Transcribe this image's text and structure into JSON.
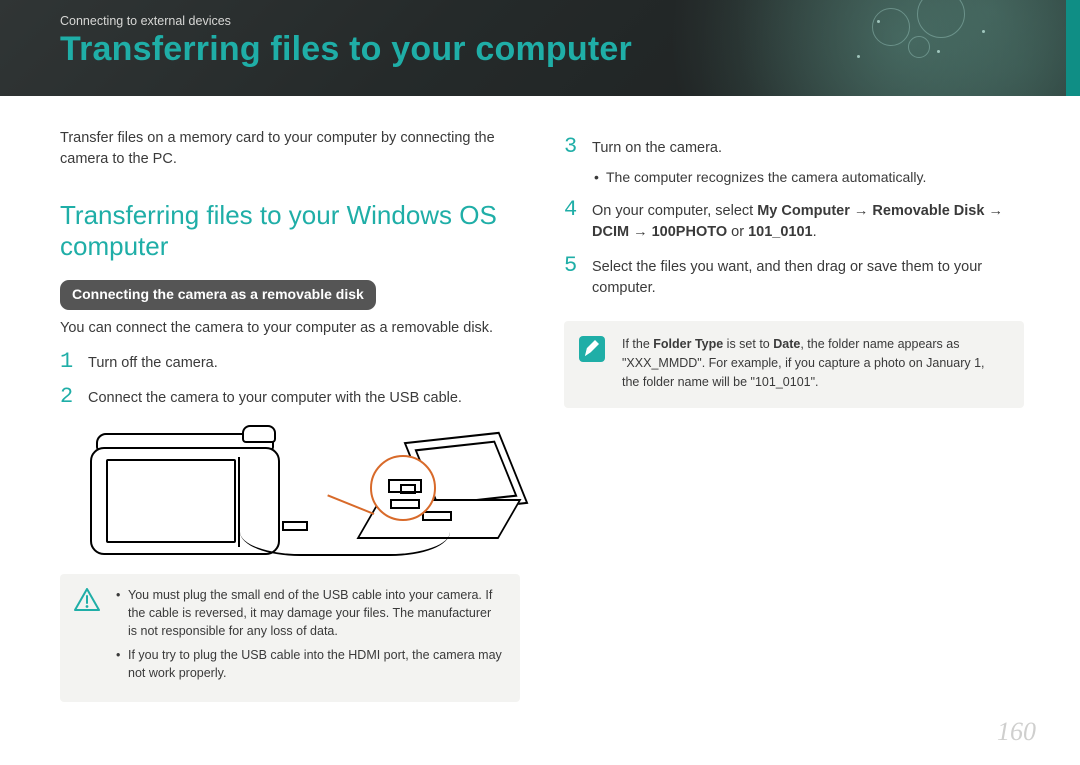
{
  "header": {
    "breadcrumb": "Connecting to external devices",
    "title": "Transferring files to your computer"
  },
  "left": {
    "intro": "Transfer files on a memory card to your computer by connecting the camera to the PC.",
    "section_heading": "Transferring files to your Windows OS computer",
    "pill": "Connecting the camera as a removable disk",
    "subnote": "You can connect the camera to your computer as a removable disk.",
    "step1_num": "1",
    "step1_text": "Turn off the camera.",
    "step2_num": "2",
    "step2_text": "Connect the camera to your computer with the USB cable.",
    "warning_items": [
      "You must plug the small end of the USB cable into your camera. If the cable is reversed, it may damage your files. The manufacturer is not responsible for any loss of data.",
      "If you try to plug the USB cable into the HDMI port, the camera may not work properly."
    ]
  },
  "right": {
    "step3_num": "3",
    "step3_text": "Turn on the camera.",
    "step3_bullet": "The computer recognizes the camera automatically.",
    "step4_num": "4",
    "step4_prefix": "On your computer, select ",
    "step4_path": "My Computer → Removable Disk → DCIM → 100PHOTO",
    "step4_or": " or ",
    "step4_alt": "101_0101",
    "step4_suffix": ".",
    "step5_num": "5",
    "step5_text": "Select the files you want, and then drag or save them to your computer.",
    "info_prefix": "If the ",
    "info_b1": "Folder Type",
    "info_mid1": " is set to ",
    "info_b2": "Date",
    "info_mid2": ", the folder name appears as \"XXX_MMDD\". For example, if you capture a photo on January 1, the folder name will be \"101_0101\"."
  },
  "page_number": "160"
}
